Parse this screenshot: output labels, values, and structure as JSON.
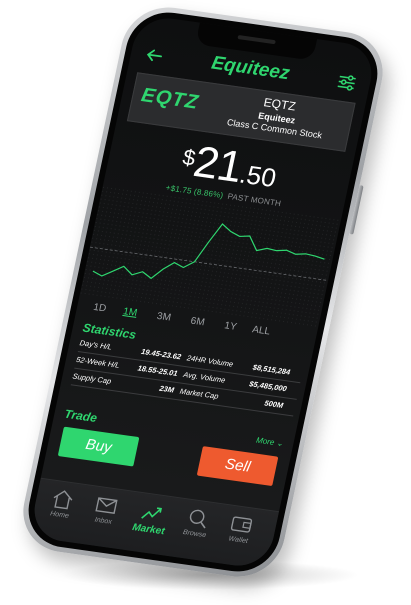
{
  "app": {
    "title": "Equiteez"
  },
  "ticker": {
    "logo_text": "EQTZ",
    "symbol": "EQTZ",
    "name": "Equiteez",
    "class": "Class C Common Stock"
  },
  "price": {
    "currency": "$",
    "whole": "21",
    "fraction": ".50",
    "change": "+$1.75 (8.86%)",
    "period": "PAST MONTH"
  },
  "chart_data": {
    "type": "line",
    "x": [
      0,
      1,
      2,
      3,
      4,
      5,
      6,
      7,
      8,
      9,
      10,
      11,
      12,
      13,
      14,
      15,
      16,
      17,
      18,
      19,
      20,
      21,
      22,
      23
    ],
    "values": [
      14.6,
      14.2,
      14.9,
      15.6,
      14.8,
      15.3,
      14.7,
      15.9,
      16.8,
      16.4,
      17.2,
      19.6,
      21.8,
      21.1,
      20.7,
      20.9,
      19.4,
      19.8,
      19.7,
      19.9,
      19.6,
      19.8,
      19.7,
      19.5
    ],
    "baseline": 17.2,
    "color": "#2fd66f",
    "ylim": [
      13,
      23
    ]
  },
  "ranges": [
    "1D",
    "1M",
    "3M",
    "6M",
    "1Y",
    "ALL"
  ],
  "active_range": "1M",
  "statistics": {
    "title": "Statistics",
    "rows": [
      {
        "l1": "Day's H/L",
        "v1": "19.45-23.62",
        "l2": "24HR Volume",
        "v2": "$8,515,284"
      },
      {
        "l1": "52-Week H/L",
        "v1": "18.55-25.01",
        "l2": "Avg. Volume",
        "v2": "$5,485,000"
      },
      {
        "l1": "Supply Cap",
        "v1": "23M",
        "l2": "Market Cap",
        "v2": "500M"
      }
    ]
  },
  "trade": {
    "title": "Trade",
    "more": "More",
    "buy": "Buy",
    "sell": "Sell"
  },
  "tabs": [
    {
      "label": "Home",
      "icon": "home-icon"
    },
    {
      "label": "Inbox",
      "icon": "mail-icon"
    },
    {
      "label": "Market",
      "icon": "chart-trend-icon"
    },
    {
      "label": "Browse",
      "icon": "search-icon"
    },
    {
      "label": "Wallet",
      "icon": "wallet-icon"
    }
  ],
  "active_tab": "Market",
  "colors": {
    "accent": "#2fd66f",
    "sell": "#ee5a2f",
    "background": "#141516"
  }
}
